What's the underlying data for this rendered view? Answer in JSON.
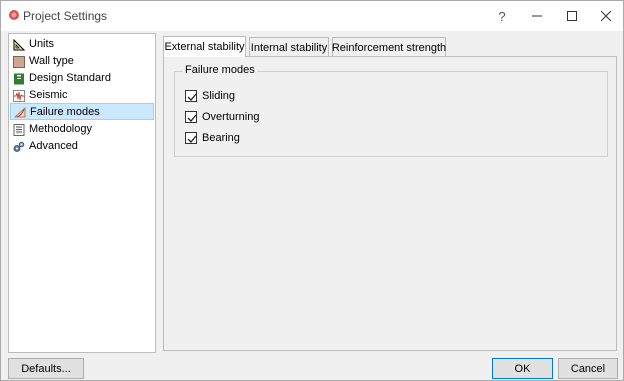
{
  "window": {
    "title": "Project Settings",
    "help_label": "?",
    "minimize_label": "—",
    "maximize_label": "☐",
    "close_label": "✕"
  },
  "sidebar": {
    "items": [
      {
        "label": "Units",
        "icon": "ruler-triangle-icon",
        "selected": false
      },
      {
        "label": "Wall type",
        "icon": "wall-icon",
        "selected": false
      },
      {
        "label": "Design Standard",
        "icon": "book-icon",
        "selected": false
      },
      {
        "label": "Seismic",
        "icon": "seismic-wave-icon",
        "selected": false
      },
      {
        "label": "Failure modes",
        "icon": "failure-slope-icon",
        "selected": true
      },
      {
        "label": "Methodology",
        "icon": "document-grid-icon",
        "selected": false
      },
      {
        "label": "Advanced",
        "icon": "gears-icon",
        "selected": false
      }
    ]
  },
  "tabs": [
    {
      "label": "External stability",
      "active": true
    },
    {
      "label": "Internal stability",
      "active": false
    },
    {
      "label": "Reinforcement strength",
      "active": false
    }
  ],
  "failure_modes": {
    "title": "Failure modes",
    "options": [
      {
        "label": "Sliding",
        "checked": true
      },
      {
        "label": "Overturning",
        "checked": true
      },
      {
        "label": "Bearing",
        "checked": true
      }
    ]
  },
  "buttons": {
    "defaults_label": "Defaults...",
    "ok_label": "OK",
    "cancel_label": "Cancel"
  },
  "colors": {
    "selection_bg": "#cce8ff",
    "selection_border": "#99d1ff",
    "ok_border": "#0078d7"
  }
}
